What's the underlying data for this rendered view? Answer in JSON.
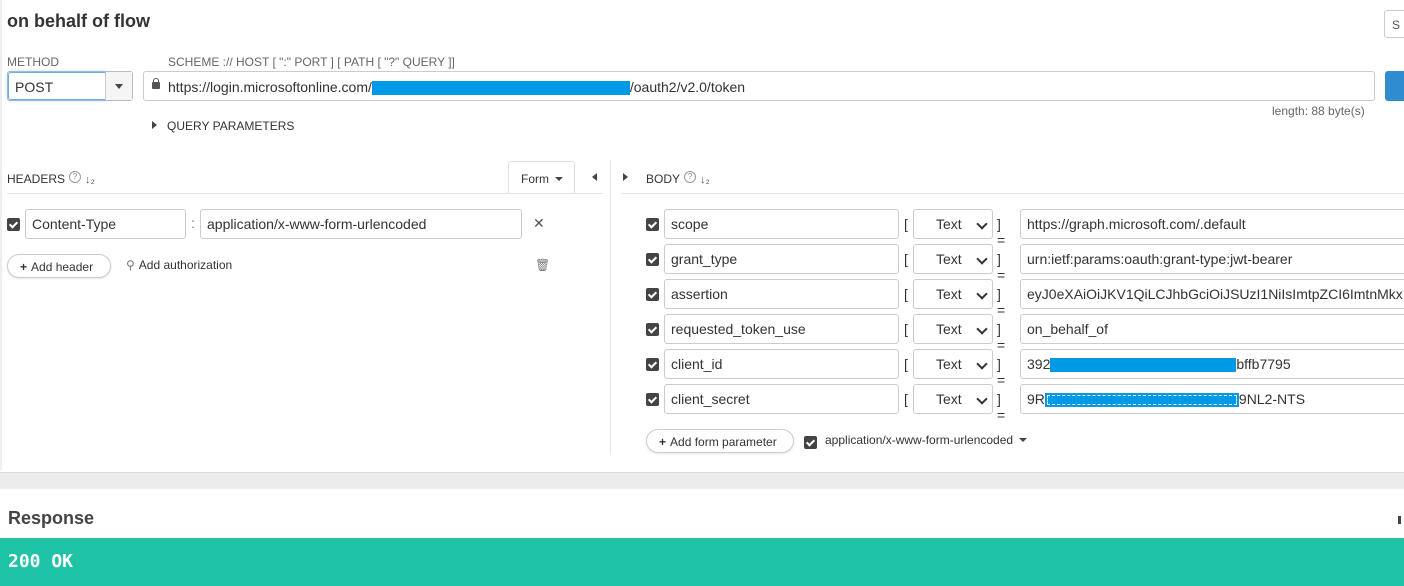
{
  "header": {
    "title": "on behalf of flow",
    "corner_button_label": "S"
  },
  "request": {
    "method_label": "METHOD",
    "method_value": "POST",
    "url_label": "SCHEME :// HOST [ \":\" PORT ] [ PATH [ \"?\" QUERY ]]",
    "url_prefix": "https://login.microsoftonline.com/",
    "url_suffix": "/oauth2/v2.0/token",
    "length_text": "length: 88 byte(s)",
    "query_params_label": "QUERY PARAMETERS"
  },
  "headers": {
    "title": "HEADERS",
    "form_button_label": "Form",
    "items": [
      {
        "name": "Content-Type",
        "value": "application/x-www-form-urlencoded",
        "checked": true
      }
    ],
    "add_header_label": "Add header",
    "add_auth_label": "Add authorization"
  },
  "body": {
    "title": "BODY",
    "params": [
      {
        "name": "scope",
        "type": "Text",
        "value": "https://graph.microsoft.com/.default"
      },
      {
        "name": "grant_type",
        "type": "Text",
        "value": "urn:ietf:params:oauth:grant-type:jwt-bearer"
      },
      {
        "name": "assertion",
        "type": "Text",
        "value": "eyJ0eXAiOiJKV1QiLCJhbGciOiJSUzI1NiIsImtpZCI6ImtnMkx"
      },
      {
        "name": "requested_token_use",
        "type": "Text",
        "value": "on_behalf_of"
      },
      {
        "name": "client_id",
        "type": "Text",
        "value_prefix": "392",
        "value_suffix": "bffb7795"
      },
      {
        "name": "client_secret",
        "type": "Text",
        "value_prefix": "9R",
        "value_suffix": "9NL2-NTS"
      }
    ],
    "add_param_label": "Add form parameter",
    "encoding_label": "application/x-www-form-urlencoded"
  },
  "response": {
    "title": "Response",
    "status": "200 OK"
  },
  "colors": {
    "accent": "#2e8ccf",
    "redaction": "#0099e6",
    "status_ok": "#1ec4a5"
  }
}
